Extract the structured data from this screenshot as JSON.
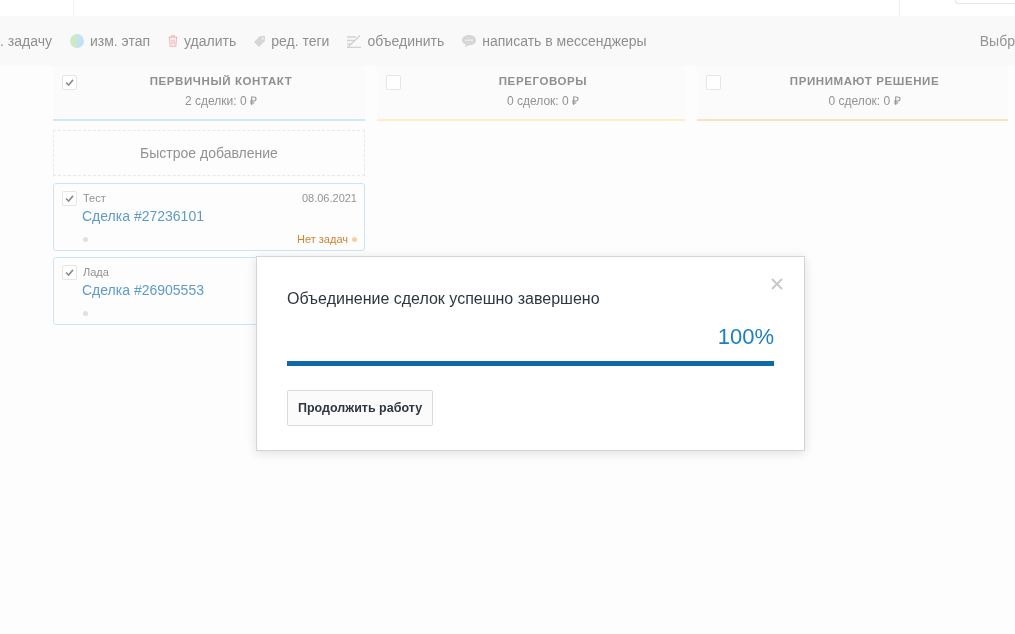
{
  "toolbar": {
    "actions": [
      {
        "kind": "plain",
        "label": ". задачу"
      },
      {
        "kind": "stage",
        "label": "изм. этап"
      },
      {
        "kind": "delete",
        "label": "удалить"
      },
      {
        "kind": "tags",
        "label": "ред. теги"
      },
      {
        "kind": "merge",
        "label": "объединить"
      },
      {
        "kind": "chat",
        "label": "написать в мессенджеры"
      }
    ],
    "right_label": "Выбр"
  },
  "columns": [
    {
      "title": "ПЕРВИЧНЫЙ КОНТАКТ",
      "summary": "2 сделки: 0 ₽",
      "checked": true,
      "color": "#cfe8fa",
      "quick_add": "Быстрое добавление",
      "deals": [
        {
          "contact": "Тест",
          "date": "08.06.2021",
          "name": "Сделка #27236101",
          "task_status": "Нет задач",
          "checked": true
        },
        {
          "contact": "Лада",
          "name": "Сделка #26905553",
          "checked": true
        }
      ]
    },
    {
      "title": "ПЕРЕГОВОРЫ",
      "summary": "0 сделок: 0 ₽",
      "checked": false,
      "color": "#fcefc6"
    },
    {
      "title": "ПРИНИМАЮТ РЕШЕНИЕ",
      "summary": "0 сделок: 0 ₽",
      "checked": false,
      "color": "#fde0c2"
    }
  ],
  "modal": {
    "title": "Объединение сделок успешно завершено",
    "percent": "100%",
    "level": 1,
    "button": "Продолжить работу"
  }
}
